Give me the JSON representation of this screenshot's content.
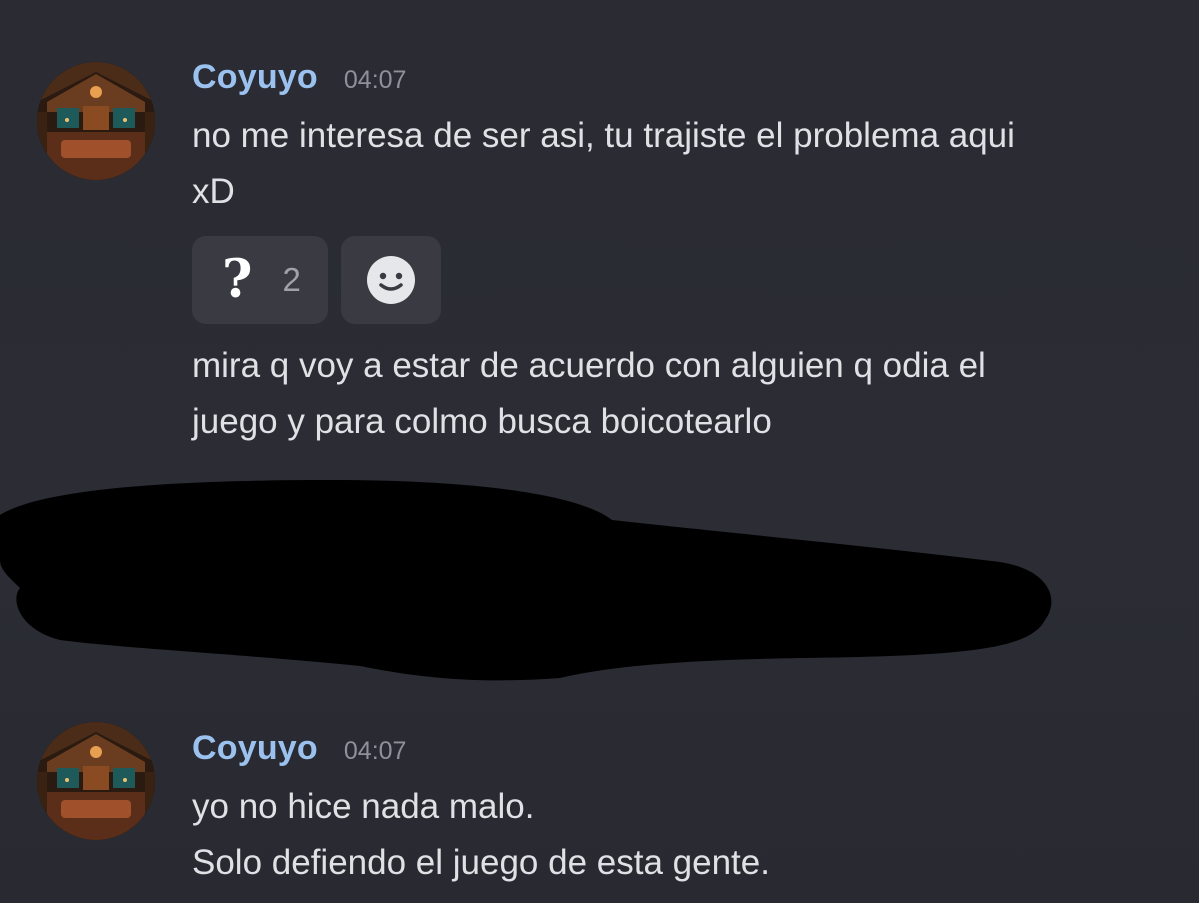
{
  "messages": [
    {
      "username": "Coyuyo",
      "timestamp": "04:07",
      "lines": [
        "no me interesa de ser asi, tu trajiste el problema aqui\nxD",
        "mira q voy a estar de acuerdo con alguien q odia el\njuego y para colmo busca boicotearlo"
      ],
      "reactions": [
        {
          "emoji": "?",
          "count": "2"
        }
      ],
      "add_reaction_icon": "add-reaction-smiley-icon"
    },
    {
      "username": "Coyuyo",
      "timestamp": "04:07",
      "lines": [
        "yo no hice nada malo.\nSolo defiendo el juego de esta gente."
      ]
    }
  ],
  "colors": {
    "background": "#2b2c33",
    "username": "#9bc1ef",
    "timestamp": "#8e9199",
    "text": "#e0e1e5",
    "reaction_bg": "#393a42",
    "redaction": "#000000"
  }
}
